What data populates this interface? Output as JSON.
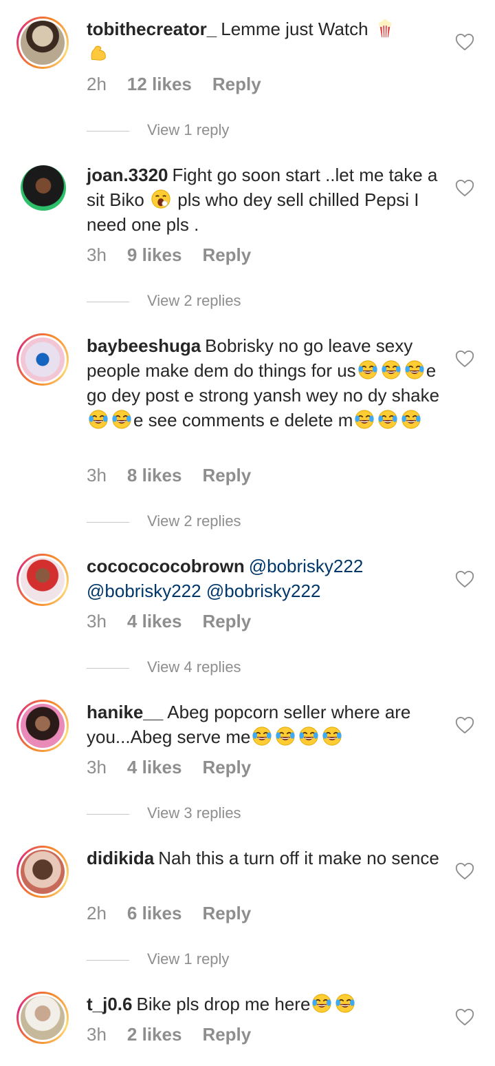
{
  "comments": [
    {
      "username": "tobithecreator_",
      "text": "Lemme just Watch",
      "time": "2h",
      "likes": "12 likes",
      "reply_label": "Reply",
      "view_replies": "View 1 reply",
      "emoji": [
        "popcorn",
        "flexed-biceps"
      ]
    },
    {
      "username": "joan.3320",
      "text1": "Fight go soon start ..let me take a  sit Biko",
      "text2": "pls who dey sell chilled Pepsi I need one pls .",
      "time": "3h",
      "likes": "9 likes",
      "reply_label": "Reply",
      "view_replies": "View 2 replies",
      "emoji": [
        "yawning-face"
      ]
    },
    {
      "username": "baybeeshuga",
      "text1": "Bobrisky no go leave sexy people make dem do things for us",
      "text2": "e go dey post e strong yansh wey no dy shake",
      "text3": "e see comments e delete m",
      "time": "3h",
      "likes": "8 likes",
      "reply_label": "Reply",
      "view_replies": "View 2 replies",
      "emoji": [
        "face-with-tears-of-joy"
      ]
    },
    {
      "username": "cococococobrown",
      "mention1": "@bobrisky222",
      "mention2": "@bobrisky222",
      "mention3": "@bobrisky222",
      "time": "3h",
      "likes": "4 likes",
      "reply_label": "Reply",
      "view_replies": "View 4 replies"
    },
    {
      "username": "hanike__",
      "text": "Abeg popcorn seller where are you...Abeg serve me",
      "time": "3h",
      "likes": "4 likes",
      "reply_label": "Reply",
      "view_replies": "View 3 replies",
      "emoji": [
        "face-with-tears-of-joy"
      ]
    },
    {
      "username": "didikida",
      "text": "Nah this a turn off it make no sence",
      "time": "2h",
      "likes": "6 likes",
      "reply_label": "Reply",
      "view_replies": "View 1 reply"
    },
    {
      "username": "t_j0.6",
      "text": "Bike pls drop me here",
      "time": "3h",
      "likes": "2 likes",
      "reply_label": "Reply",
      "emoji": [
        "face-with-tears-of-joy"
      ]
    }
  ],
  "icons": {
    "like": "heart-outline-icon"
  },
  "colors": {
    "text": "#262626",
    "secondary": "#8e8e8e",
    "mention": "#00376b",
    "story_ring_start": "#f58529",
    "story_ring_end": "#dd2a7b"
  }
}
